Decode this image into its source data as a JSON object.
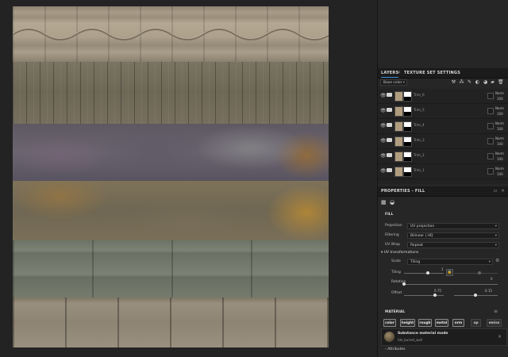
{
  "layers_panel": {
    "tab_layers": "LAYERS",
    "tab_texture_set": "TEXTURE SET SETTINGS",
    "channel_dropdown": "Base color",
    "items": [
      {
        "name": "Trim_6",
        "blend": "Norm",
        "opacity": "100"
      },
      {
        "name": "Trim_5",
        "blend": "Norm",
        "opacity": "100"
      },
      {
        "name": "Trim_4",
        "blend": "Norm",
        "opacity": "100"
      },
      {
        "name": "Trim_3",
        "blend": "Norm",
        "opacity": "100"
      },
      {
        "name": "Trim_2",
        "blend": "Norm",
        "opacity": "100"
      },
      {
        "name": "Trim_1",
        "blend": "Norm",
        "opacity": "100"
      }
    ]
  },
  "properties": {
    "title": "PROPERTIES - FILL",
    "fill_section": "FILL",
    "projection_label": "Projection",
    "projection_value": "UV projection",
    "filtering_label": "Filtering",
    "filtering_value": "Bilinear | HQ",
    "uvwrap_label": "UV Wrap",
    "uvwrap_value": "Repeat",
    "uv_transformations": "UV transformations",
    "scale_label": "Scale",
    "scale_value": "Tiling",
    "tiling_label": "Tiling",
    "tiling_value": "1",
    "rotation_label": "Rotation",
    "rotation_value": "0",
    "offset_label": "Offset",
    "offset_x": "0.75",
    "offset_y": "0.15"
  },
  "material": {
    "section": "MATERIAL",
    "channels": [
      "color",
      "height",
      "rough",
      "metal",
      "nrm",
      "op",
      "emiss"
    ],
    "substance_title": "Substance material mode",
    "substance_name": "tile_buried_wall",
    "attributes": "Attributes"
  },
  "colors": {
    "accent": "#3d8ee0",
    "panel_bg": "#262626",
    "viewport_bg": "#232323"
  }
}
